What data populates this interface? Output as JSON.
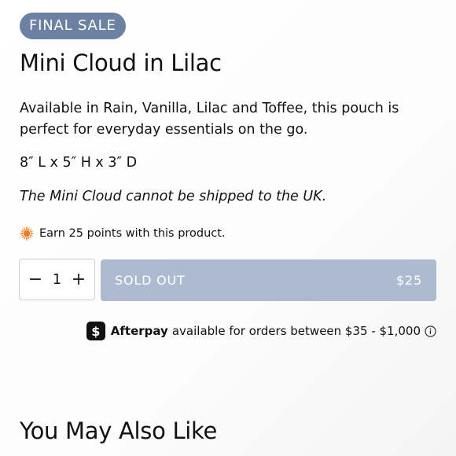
{
  "product": {
    "badge": "FINAL SALE",
    "title": "Mini Cloud in Lilac",
    "description": "Available in Rain, Vanilla, Lilac and Toffee, this pouch is perfect for everyday essentials on the go.",
    "dimensions": "8″ L x 5″ H x 3″ D",
    "shipping_note": "The Mini Cloud cannot be shipped to the UK."
  },
  "rewards": {
    "icon": "sun-icon",
    "text": "Earn 25 points with this product."
  },
  "quantity": {
    "decrement_label": "−",
    "value": "1",
    "increment_label": "+"
  },
  "buy_button": {
    "label": "SOLD OUT",
    "price": "$25",
    "color": "#aebad0"
  },
  "afterpay": {
    "logo_glyph": "$",
    "brand": "Afterpay",
    "text": "available for orders between $35 - $1,000",
    "info_icon": "info-icon"
  },
  "recommendations": {
    "heading": "You May Also Like"
  },
  "colors": {
    "badge_bg": "#6d82a3",
    "accent_sun": "#f47b20"
  }
}
